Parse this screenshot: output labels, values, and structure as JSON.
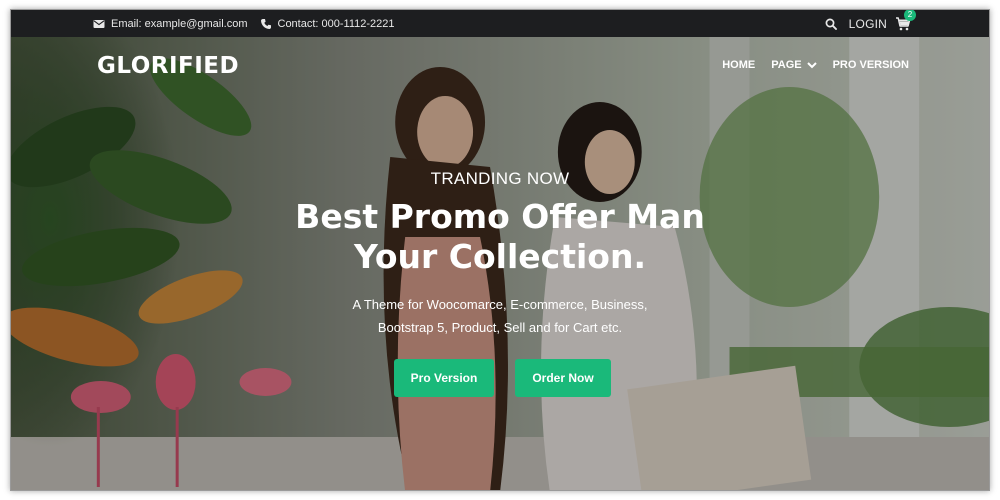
{
  "topbar": {
    "email_label": "Email: example@gmail.com",
    "contact_label": "Contact: 000-1112-2221",
    "login_label": "LOGIN",
    "cart_count": "2"
  },
  "brand": {
    "logo": "GLORIFIED"
  },
  "nav": {
    "items": [
      "HOME",
      "PAGE",
      "PRO VERSION"
    ]
  },
  "hero": {
    "eyebrow": "TRANDING NOW",
    "headline_line1": "Best Promo Offer Man",
    "headline_line2": "Your Collection.",
    "desc_line1": "A Theme for Woocomarce, E-commerce, Business,",
    "desc_line2": "Bootstrap 5, Product, Sell and for Cart etc.",
    "primary_button": "Pro Version",
    "secondary_button": "Order Now"
  },
  "colors": {
    "accent": "#1ab97a",
    "topbar_bg": "#1d1e20"
  }
}
